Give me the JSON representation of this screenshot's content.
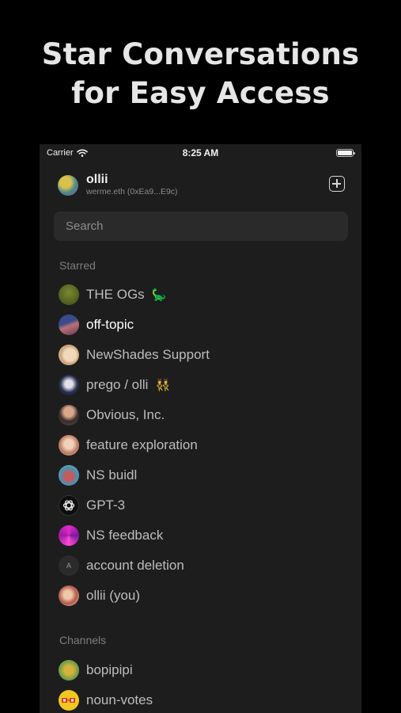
{
  "headline": {
    "line1": "Star Conversations",
    "line2": "for Easy Access"
  },
  "status_bar": {
    "carrier": "Carrier",
    "time": "8:25 AM",
    "icons": [
      "wifi-icon",
      "battery-icon"
    ]
  },
  "account": {
    "name": "ollii",
    "address": "werme.eth (0xEa9...E9c)",
    "compose_icon": "new-message-icon"
  },
  "search": {
    "placeholder": "Search"
  },
  "starred": {
    "label": "Starred",
    "items": [
      {
        "name": "THE OGs",
        "emoji": "🦕",
        "avatar_color": "#5a6a2a"
      },
      {
        "name": "off-topic",
        "emoji": "",
        "avatar_color": "#8a5a7a"
      },
      {
        "name": "NewShades Support",
        "emoji": "",
        "avatar_color": "#e0c8a8"
      },
      {
        "name": "prego / olli",
        "emoji": "👯",
        "avatar_color": "#3a4a6a"
      },
      {
        "name": "Obvious, Inc.",
        "emoji": "",
        "avatar_color": "#5a3a2e"
      },
      {
        "name": "feature exploration",
        "emoji": "",
        "avatar_color": "#c89a7a"
      },
      {
        "name": "NS buidl",
        "emoji": "",
        "avatar_color": "#5a8aa0"
      },
      {
        "name": "GPT-3",
        "emoji": "",
        "avatar_color": "#111111",
        "icon": "openai-icon"
      },
      {
        "name": "NS feedback",
        "emoji": "",
        "avatar_color": "#c42ab0"
      },
      {
        "name": "account deletion",
        "emoji": "",
        "avatar_color": "#2b2b2b",
        "initial": "A"
      },
      {
        "name": "ollii (you)",
        "emoji": "",
        "avatar_color": "#b06a5a"
      }
    ]
  },
  "channels": {
    "label": "Channels",
    "items": [
      {
        "name": "bopipipi",
        "avatar_color": "#8aa040"
      },
      {
        "name": "noun-votes",
        "avatar_color": "#e8c020"
      }
    ]
  }
}
